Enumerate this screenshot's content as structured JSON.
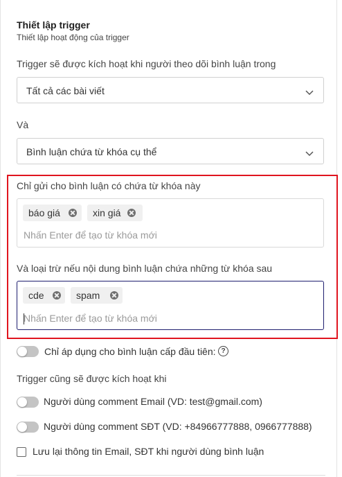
{
  "section": {
    "title": "Thiết lập trigger",
    "subtitle": "Thiết lập hoạt động của trigger"
  },
  "trigger_source": {
    "label": "Trigger sẽ được kích hoạt khi người theo dõi bình luận trong",
    "selected": "Tất cả các bài viết"
  },
  "condition": {
    "label": "Và",
    "selected": "Bình luận chứa từ khóa cụ thể"
  },
  "include_keywords": {
    "label": "Chỉ gửi cho bình luận có chứa từ khóa này",
    "tags": [
      "báo giá",
      "xin giá"
    ],
    "placeholder": "Nhấn Enter để tạo từ khóa mới"
  },
  "exclude_keywords": {
    "label": "Và loại trừ nếu nội dung bình luận chứa những từ khóa sau",
    "tags": [
      "cde",
      "spam"
    ],
    "placeholder": "Nhấn Enter để tạo từ khóa mới"
  },
  "first_level_toggle": {
    "label": "Chỉ áp dụng cho bình luận cấp đầu tiên:",
    "enabled": false,
    "help_icon": "question-circle-icon"
  },
  "also_trigger": {
    "label": "Trigger cũng sẽ được kích hoạt khi",
    "options": [
      {
        "label": "Người dùng comment Email (VD: test@gmail.com)",
        "enabled": false
      },
      {
        "label": "Người dùng comment SĐT (VD: +84966777888, 0966777888)",
        "enabled": false
      }
    ]
  },
  "save_info": {
    "label": "Lưu lại thông tin Email, SĐT khi người dùng bình luận",
    "checked": false
  },
  "colors": {
    "highlight_border": "#e0141e",
    "focus_border": "#1d1d6e",
    "tag_bg": "#f0f0f0",
    "toggle_off": "#c4c4c4"
  }
}
